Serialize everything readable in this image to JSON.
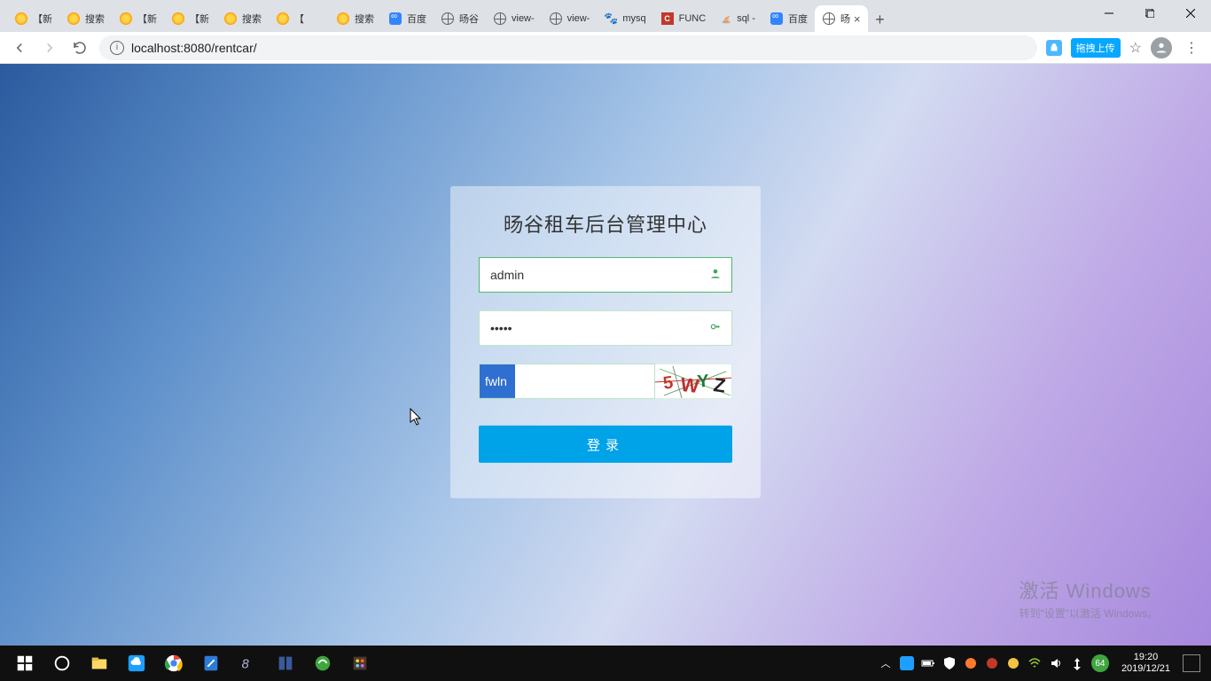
{
  "browser": {
    "tabs": [
      {
        "label": "【新"
      },
      {
        "label": "搜索"
      },
      {
        "label": "【新"
      },
      {
        "label": "【新"
      },
      {
        "label": "搜索"
      },
      {
        "label": "【"
      },
      {
        "label": "搜索"
      },
      {
        "label": "百度"
      },
      {
        "label": "旸谷"
      },
      {
        "label": "view-"
      },
      {
        "label": "view-"
      },
      {
        "label": "mysq"
      },
      {
        "label": "FUNC"
      },
      {
        "label": "sql -"
      },
      {
        "label": "百度"
      },
      {
        "label": "旸"
      }
    ],
    "url": "localhost:8080/rentcar/",
    "extension_label": "拖拽上传"
  },
  "page": {
    "title": "旸谷租车后台管理中心",
    "username_value": "admin",
    "password_value": "•••••",
    "captcha_value": "fwln",
    "captcha_image_text": "5WYZ",
    "login_button": "登录",
    "watermark_line1": "激活 Windows",
    "watermark_line2": "转到\"设置\"以激活 Windows。"
  },
  "taskbar": {
    "time": "19:20",
    "date": "2019/12/21",
    "tray_badge": "64"
  }
}
